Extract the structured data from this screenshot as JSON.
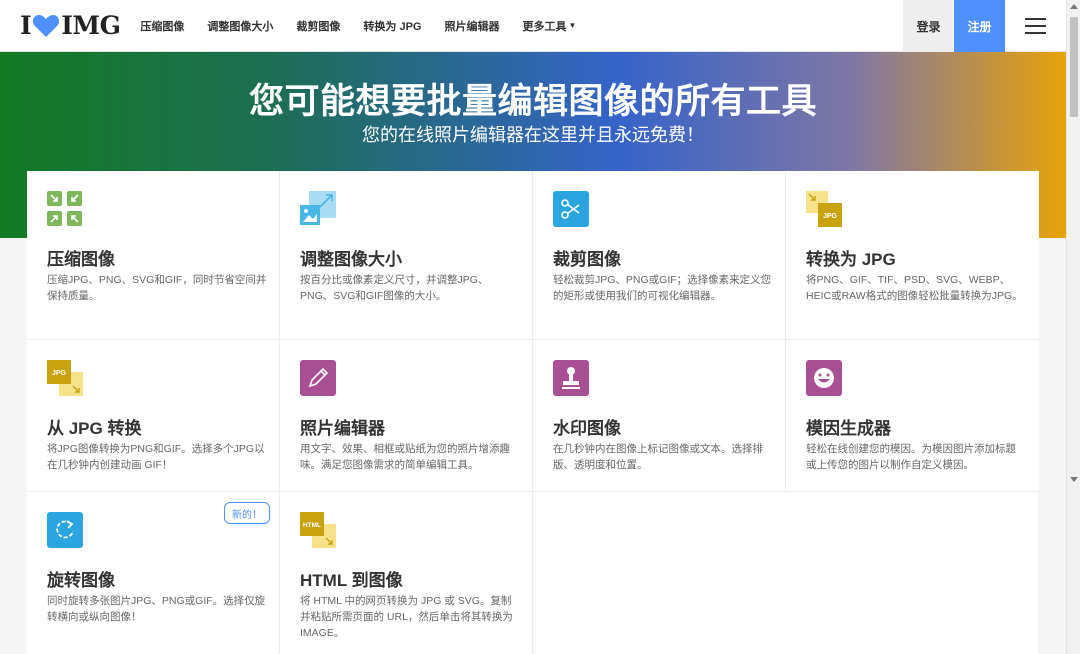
{
  "header": {
    "logo_left": "I",
    "logo_right": "IMG",
    "nav": [
      {
        "label": "压缩图像"
      },
      {
        "label": "调整图像大小"
      },
      {
        "label": "裁剪图像"
      },
      {
        "label": "转换为 JPG"
      },
      {
        "label": "照片编辑器"
      },
      {
        "label": "更多工具"
      }
    ],
    "login": "登录",
    "register": "注册"
  },
  "hero": {
    "title": "您可能想要批量编辑图像的所有工具",
    "subtitle": "您的在线照片编辑器在这里并且永远免费！"
  },
  "tools": [
    {
      "title": "压缩图像",
      "desc": "压缩JPG、PNG、SVG和GIF，同时节省空间并保持质量。",
      "icon": "compress-icon",
      "color": "#7fb85b"
    },
    {
      "title": "调整图像大小",
      "desc": "按百分比或像素定义尺寸，并调整JPG、PNG、SVG和GIF图像的大小。",
      "icon": "resize-icon",
      "color": "#48b7e6"
    },
    {
      "title": "裁剪图像",
      "desc": "轻松裁剪JPG、PNG或GIF；选择像素来定义您的矩形或使用我们的可视化编辑器。",
      "icon": "scissors-icon",
      "color": "#2aa5e0"
    },
    {
      "title": "转换为 JPG",
      "desc": "将PNG、GIF、TIF、PSD、SVG、WEBP、HEIC或RAW格式的图像轻松批量转换为JPG。",
      "icon": "convert-to-jpg-icon",
      "color": "#e6c12a"
    },
    {
      "title": "从 JPG 转换",
      "desc": "将JPG图像转换为PNG和GIF。选择多个JPG以在几秒钟内创建动画 GIF！",
      "icon": "convert-from-jpg-icon",
      "color": "#e6c12a"
    },
    {
      "title": "照片编辑器",
      "desc": "用文字、效果、相框或贴纸为您的照片增添趣味。满足您图像需求的简单编辑工具。",
      "icon": "pencil-icon",
      "color": "#a94f93"
    },
    {
      "title": "水印图像",
      "desc": "在几秒钟内在图像上标记图像或文本。选择排版、透明度和位置。",
      "icon": "stamp-icon",
      "color": "#a94f93"
    },
    {
      "title": "模因生成器",
      "desc": "轻松在线创建您的模因。为模因图片添加标题或上传您的图片以制作自定义模因。",
      "icon": "smiley-icon",
      "color": "#a94f93"
    },
    {
      "title": "旋转图像",
      "desc": "同时旋转多张图片JPG、PNG或GIF。选择仅旋转横向或纵向图像！",
      "icon": "rotate-icon",
      "color": "#2aa5e0"
    },
    {
      "title": "HTML 到图像",
      "desc": "将 HTML 中的网页转换为 JPG 或 SVG。复制并粘贴所需页面的 URL，然后单击将其转换为 IMAGE。",
      "icon": "html-icon",
      "color": "#e6c12a"
    }
  ],
  "badge": "新的！",
  "icon_labels": {
    "jpg": "JPG",
    "html": "HTML"
  }
}
